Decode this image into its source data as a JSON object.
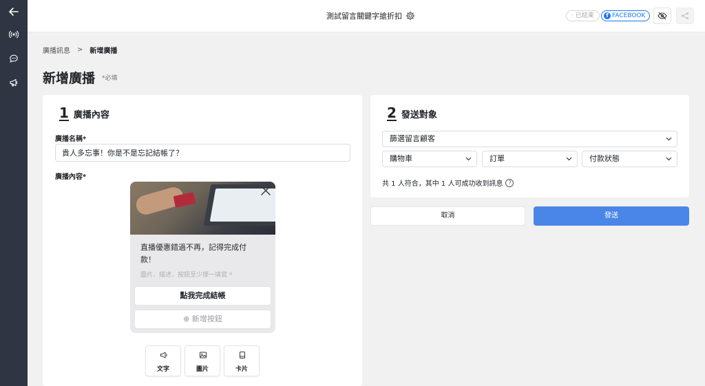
{
  "topbar": {
    "title": "測試留言關鍵字搶折扣",
    "ended_label": "已結束",
    "facebook_label": "FACEBOOK"
  },
  "breadcrumb": {
    "parent": "廣播訊息",
    "separator": ">",
    "current": "新增廣播"
  },
  "page": {
    "title": "新增廣播",
    "required_note": "*必填"
  },
  "content_section": {
    "number": "1",
    "title": "廣播內容",
    "name_label": "廣播名稱*",
    "name_value": "貴人多忘事！你是不是忘記結帳了？",
    "content_label": "廣播內容*",
    "card": {
      "text": "直播優惠錯過不再，記得完成付款！",
      "hint": "圖片、描述、按鈕至少擇一填寫 *",
      "button_label": "點我完成結帳",
      "add_button_label": "新增按鈕"
    },
    "types": [
      {
        "label": "文字",
        "icon": "megaphone-icon"
      },
      {
        "label": "圖片",
        "icon": "image-icon"
      },
      {
        "label": "卡片",
        "icon": "card-icon"
      }
    ]
  },
  "target_section": {
    "number": "2",
    "title": "發送對象",
    "filter_select": "篩選留言顧客",
    "cart_select": "購物車",
    "order_select": "訂單",
    "payment_select": "付款狀態",
    "match_text": "共 1 人符合，其中 1 人可成功收到訊息"
  },
  "actions": {
    "cancel_label": "取消",
    "send_label": "發送"
  },
  "colors": {
    "sidebar": "#2f3542",
    "primary": "#4a86e8",
    "facebook": "#1877f2"
  }
}
